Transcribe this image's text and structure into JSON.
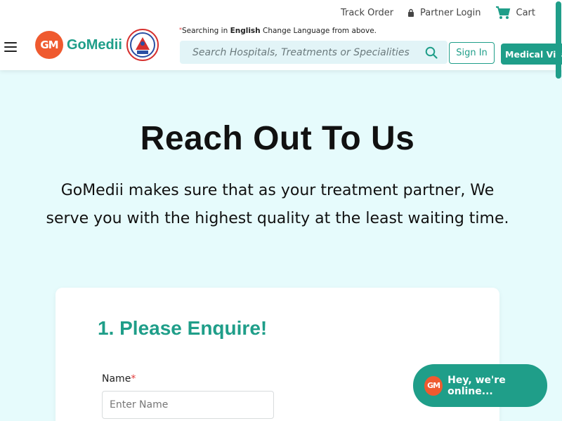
{
  "header": {
    "top_links": [
      {
        "label": "Track Order"
      },
      {
        "label": "Partner Login",
        "icon": "lock-icon"
      },
      {
        "label": "Cart",
        "icon": "cart-icon"
      }
    ],
    "logo_mark": "GM",
    "logo_text": "GoMedii",
    "language_note": {
      "prefix": "Searching in ",
      "language": "English",
      "suffix": " Change Language from above."
    },
    "search_placeholder": "Search Hospitals, Treatments or Specialities",
    "signin_label": "Sign In",
    "visa_label": "Medical Visa"
  },
  "hero": {
    "title": "Reach Out To Us",
    "subtitle_line1": "GoMedii makes sure that as your treatment partner, We",
    "subtitle_line2": "serve you with the highest quality at the least waiting time."
  },
  "form": {
    "step_title": "1. Please Enquire!",
    "name_label": "Name",
    "required_mark": "*",
    "name_placeholder": "Enter Name"
  },
  "chat": {
    "logo_mark": "GM",
    "label": "Hey, we're online..."
  },
  "colors": {
    "brand_teal": "#1f9e89",
    "brand_orange": "#ef5a2f",
    "hero_bg": "#e6fbfc",
    "required_red": "#e23b3b"
  }
}
